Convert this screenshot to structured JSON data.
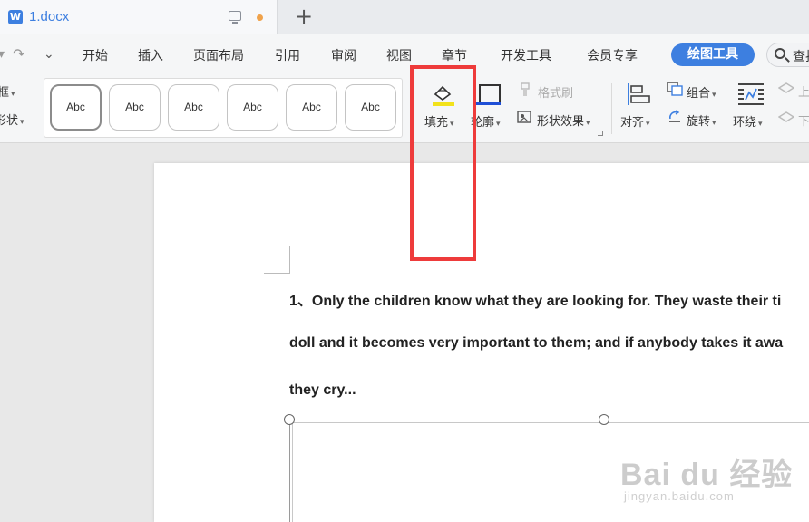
{
  "tab": {
    "app_logo": "W",
    "doc_name": "1.docx",
    "new_tab": "+"
  },
  "menu": {
    "undo": "↶",
    "redo": "↷",
    "more": "⌄",
    "items": [
      "开始",
      "插入",
      "页面布局",
      "引用",
      "审阅",
      "视图",
      "章节",
      "开发工具",
      "会员专享"
    ],
    "active": "绘图工具",
    "search_label": "查找"
  },
  "ribbon": {
    "left_labels": [
      "框",
      "形状"
    ],
    "style_labels": [
      "Abc",
      "Abc",
      "Abc",
      "Abc",
      "Abc",
      "Abc"
    ],
    "fill": "填充",
    "outline": "轮廓",
    "format_painter": "格式刷",
    "shape_effects": "形状效果",
    "align": "对齐",
    "group": "组合",
    "rotate": "旋转",
    "wrap": "环绕",
    "up": "上",
    "down": "下"
  },
  "document": {
    "lines": [
      "1、Only the children know what they are looking for. They waste their ti",
      "doll and it becomes very important to them; and if anybody takes it awa",
      "they cry..."
    ]
  },
  "watermark": {
    "main": "Bai du 经验",
    "sub": "jingyan.baidu.com"
  },
  "colors": {
    "accent": "#3d7fe0",
    "highlight": "#ee3b3b",
    "unsaved": "#f0a24a"
  }
}
